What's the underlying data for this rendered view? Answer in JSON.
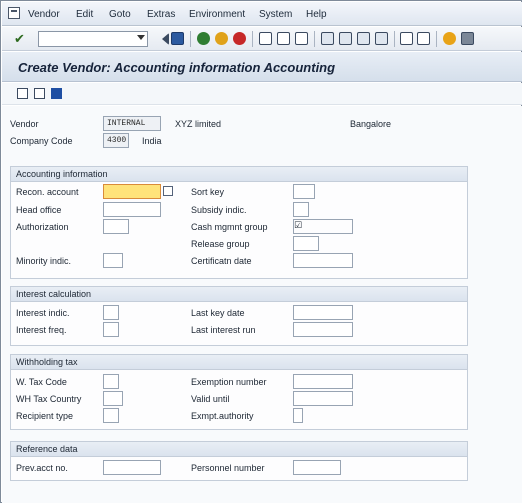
{
  "menu": {
    "items": [
      "Vendor",
      "Edit",
      "Goto",
      "Extras",
      "Environment",
      "System",
      "Help"
    ]
  },
  "toolbar": {
    "command_value": ""
  },
  "title": "Create Vendor: Accounting information Accounting",
  "header": {
    "vendor_label": "Vendor",
    "vendor_value": "INTERNAL",
    "vendor_name": "XYZ limited",
    "vendor_city": "Bangalore",
    "company_code_label": "Company Code",
    "company_code_value": "4300",
    "company_country": "India"
  },
  "accounting": {
    "heading": "Accounting information",
    "recon_account": "Recon. account",
    "sort_key": "Sort key",
    "head_office": "Head office",
    "subsidy_indic": "Subsidy indic.",
    "authorization": "Authorization",
    "cash_mgmnt_group": "Cash mgmnt group",
    "cash_mgmnt_group_checked": "☑",
    "release_group": "Release group",
    "minority_indic": "Minority indic.",
    "certificatn_date": "Certificatn date"
  },
  "interest": {
    "heading": "Interest calculation",
    "interest_indic": "Interest indic.",
    "last_key_date": "Last key date",
    "interest_freq": "Interest freq.",
    "last_interest_run": "Last interest run"
  },
  "withholding": {
    "heading": "Withholding tax",
    "w_tax_code": "W. Tax Code",
    "exemption_number": "Exemption number",
    "wh_tax_country": "WH Tax Country",
    "valid_until": "Valid  until",
    "recipient_type": "Recipient type",
    "exmpt_authority": "Exmpt.authority"
  },
  "reference": {
    "heading": "Reference data",
    "prev_acct_no": "Prev.acct no.",
    "personnel_number": "Personnel number"
  },
  "colors": {
    "focus_field": "#ffe37a",
    "title_bg": "#d5dfeb"
  }
}
